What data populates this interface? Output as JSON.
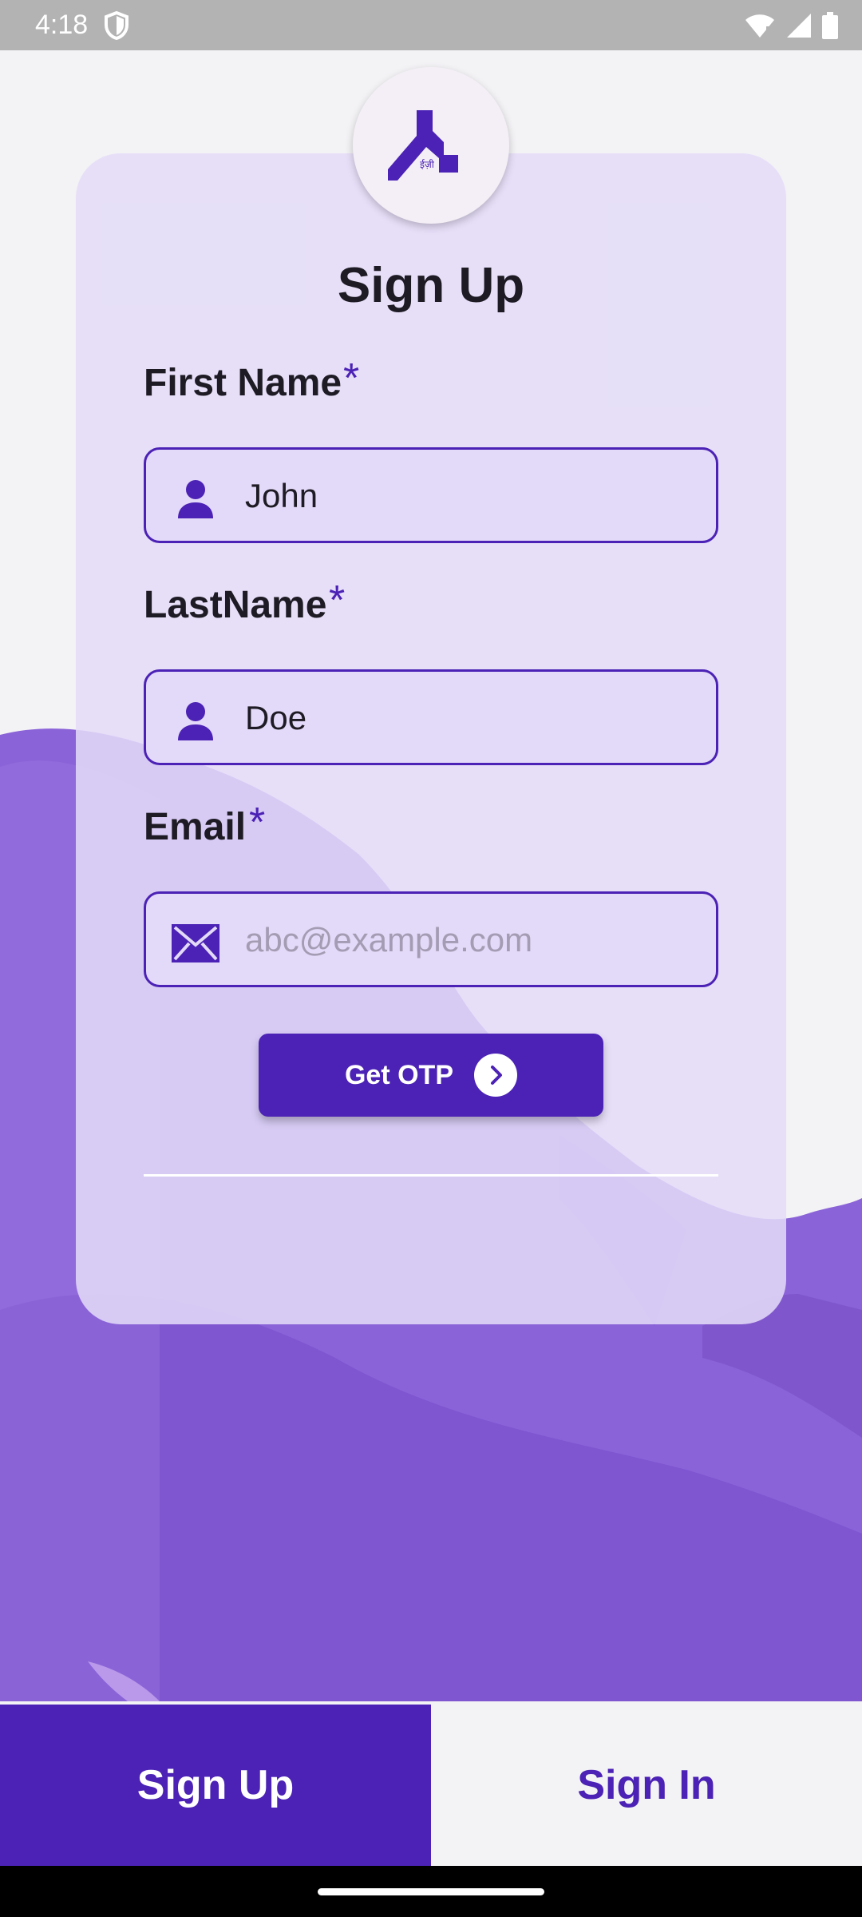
{
  "status_bar": {
    "time": "4:18"
  },
  "logo": {
    "icon": "brand-logo-icon",
    "tagline": "ईज़ी"
  },
  "form": {
    "title": "Sign Up",
    "required_mark": "*",
    "first_name": {
      "label": "First Name",
      "value": "John",
      "icon": "person-icon"
    },
    "last_name": {
      "label": "LastName",
      "value": "Doe",
      "icon": "person-icon"
    },
    "email": {
      "label": "Email",
      "value": "",
      "placeholder": "abc@example.com",
      "icon": "mail-icon"
    },
    "otp_button": {
      "label": "Get OTP",
      "icon": "chevron-right-icon"
    }
  },
  "tabs": [
    {
      "label": "Sign Up",
      "active": true
    },
    {
      "label": "Sign In",
      "active": false
    }
  ],
  "colors": {
    "accent": "#4b22b5",
    "card": "#e4dcf8",
    "input_fill": "#e3d9f8",
    "background": "#f3f2f5",
    "artwork": "#8a63d8"
  }
}
